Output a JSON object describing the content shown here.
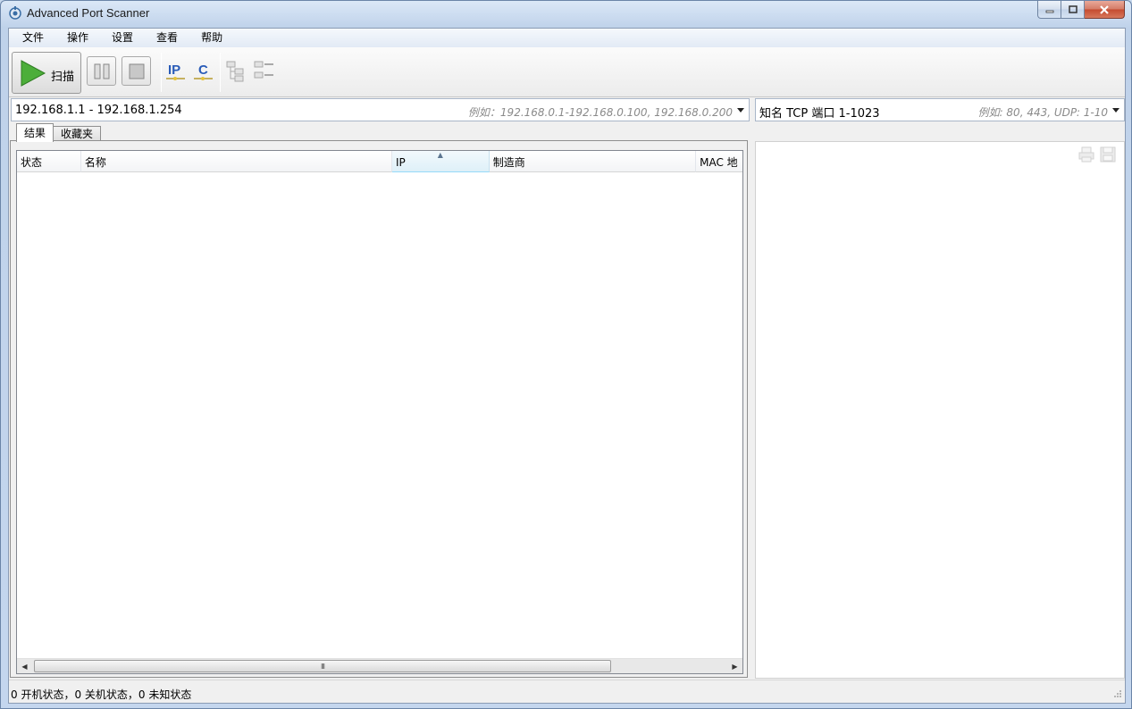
{
  "window": {
    "title": "Advanced Port Scanner"
  },
  "menu": [
    "文件",
    "操作",
    "设置",
    "查看",
    "帮助"
  ],
  "toolbar": {
    "scan_label": "扫描",
    "ip_label": "IP",
    "c_label": "C"
  },
  "range": {
    "value": "192.168.1.1 - 192.168.1.254",
    "hint": "例如：192.168.0.1-192.168.0.100, 192.168.0.200"
  },
  "ports": {
    "value": "知名 TCP 端口 1-1023",
    "hint": "例如: 80, 443, UDP: 1-10"
  },
  "tabs": [
    "结果",
    "收藏夹"
  ],
  "columns": [
    "状态",
    "名称",
    "IP",
    "制造商",
    "MAC 地"
  ],
  "status": {
    "text": "0 开机状态，0 关机状态，0 未知状态"
  },
  "scrollbar": {
    "grip": "III"
  }
}
